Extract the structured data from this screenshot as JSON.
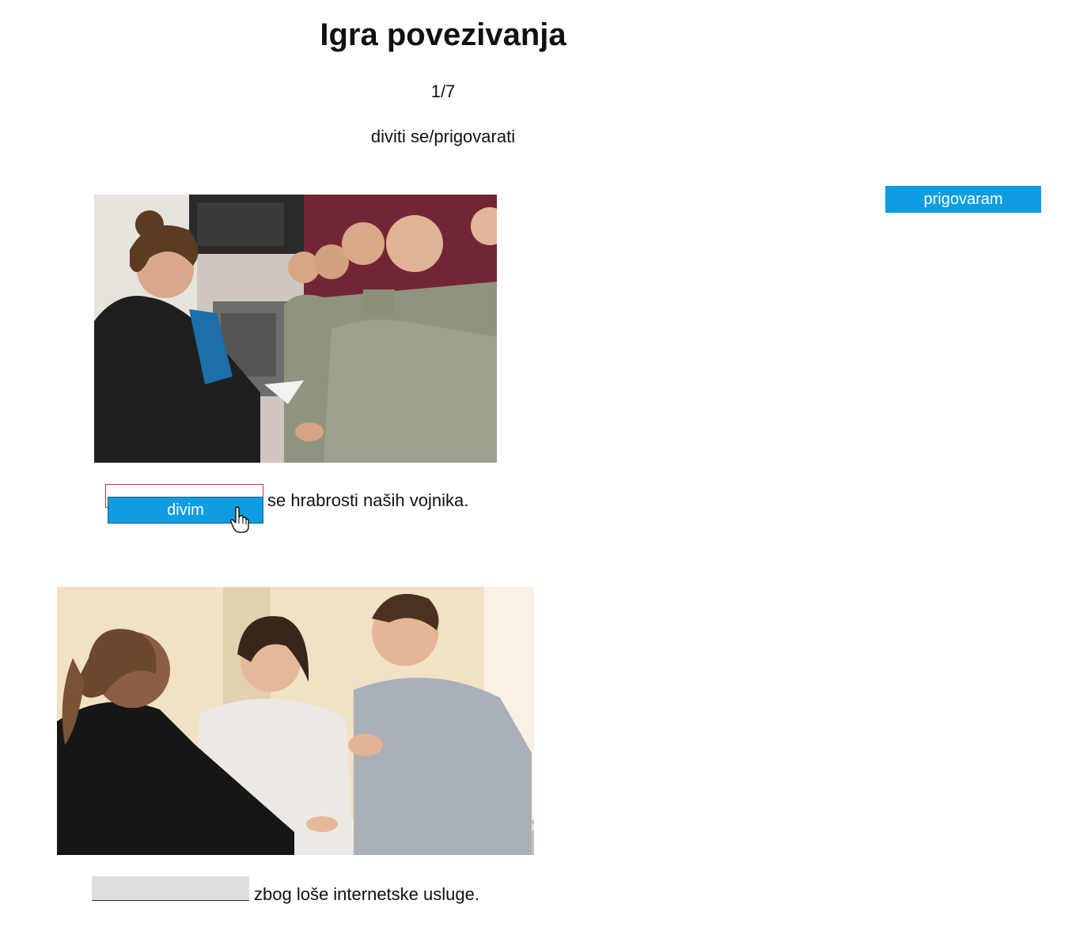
{
  "page": {
    "title": "Igra povezivanja",
    "progress": "1/7",
    "verb_pair": "diviti se/prigovarati"
  },
  "word_bank": {
    "chip_label": "prigovaram"
  },
  "exercises": [
    {
      "image": "soldiers-handshake-photo",
      "answer_chip": "divim",
      "sentence": "se hrabrosti naših vojnika."
    },
    {
      "image": "office-complaint-photo",
      "sentence": "zbog loše internetske usluge."
    }
  ],
  "colors": {
    "chip_background": "#0f9ce0",
    "chip_text": "#ffffff",
    "drop_target_border_active": "#d0332f",
    "drop_target_empty": "#dedede"
  },
  "icons": {
    "cursor": "hand-pointer-icon"
  }
}
